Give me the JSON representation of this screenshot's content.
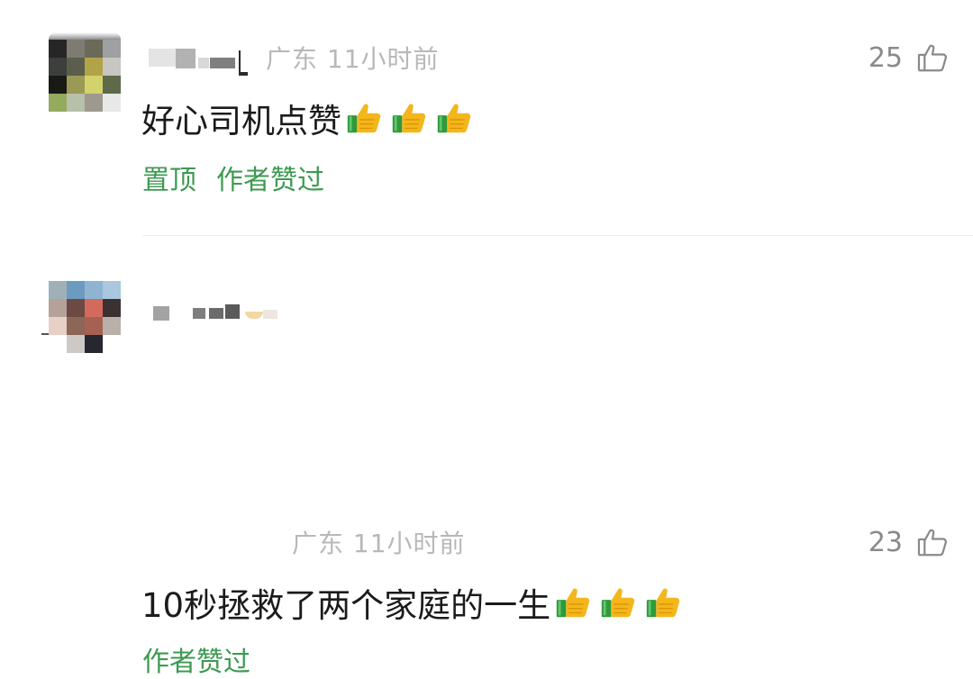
{
  "comments": [
    {
      "location": "广东",
      "time": "11小时前",
      "like_count": "25",
      "text": "好心司机点赞",
      "thumbs_count": 3,
      "actions": [
        "置顶",
        "作者赞过"
      ]
    },
    {
      "location": "广东",
      "time": "11小时前",
      "like_count": "23",
      "text": "10秒拯救了两个家庭的一生",
      "thumbs_count": 3,
      "actions": [
        "作者赞过"
      ]
    }
  ],
  "colors": {
    "action_green": "#3d9a52",
    "meta_gray": "#b8b8b8",
    "text_dark": "#1b1b1b",
    "like_gray": "#8a8a8a"
  },
  "icons": {
    "like": "thumbs-up-outline-icon",
    "emoji": "thumbs-up-emoji-icon"
  }
}
